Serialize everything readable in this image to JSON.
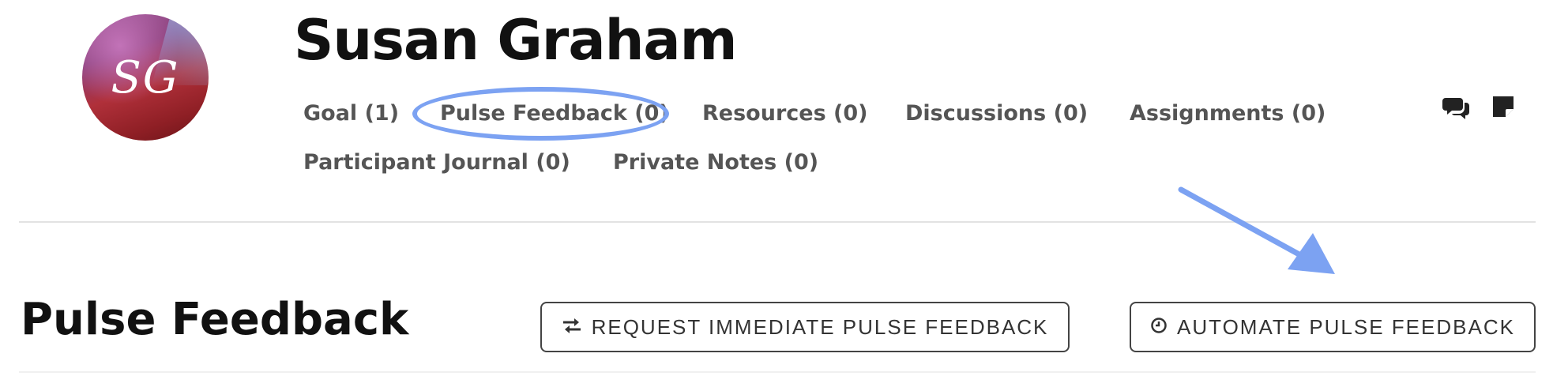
{
  "profile": {
    "initials": "SG",
    "name": "Susan Graham"
  },
  "tabs": [
    {
      "label": "Goal (1)"
    },
    {
      "label": "Pulse Feedback (0)"
    },
    {
      "label": "Resources (0)"
    },
    {
      "label": "Discussions (0)"
    },
    {
      "label": "Assignments (0)"
    },
    {
      "label": "Participant Journal (0)"
    },
    {
      "label": "Private Notes (0)"
    }
  ],
  "toolbar_icons": [
    "chat-icon",
    "note-icon"
  ],
  "section": {
    "title": "Pulse Feedback"
  },
  "actions": {
    "request_label": "REQUEST IMMEDIATE PULSE FEEDBACK",
    "automate_label": "AUTOMATE PULSE FEEDBACK"
  },
  "colors": {
    "annotation": "#7ca2f2",
    "tab_text": "#555555",
    "title_text": "#111111"
  }
}
